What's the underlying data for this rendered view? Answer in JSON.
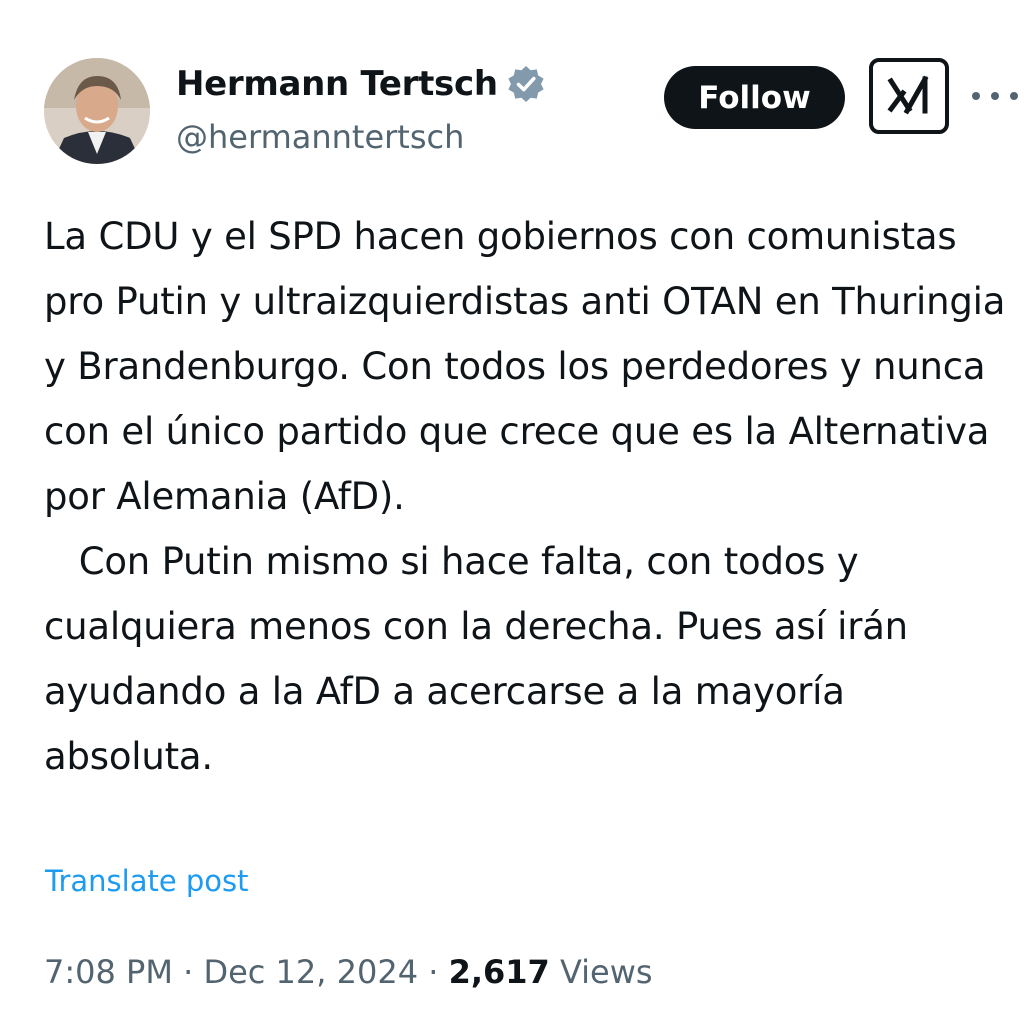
{
  "author": {
    "display_name": "Hermann Tertsch",
    "handle": "@hermanntertsch",
    "verified": true
  },
  "actions": {
    "follow_label": "Follow"
  },
  "tweet": {
    "paragraph_1": "La CDU y el SPD hacen gobiernos con comunistas pro Putin y ultraizquierdistas anti OTAN en Thuringia y Brandenburgo. Con todos los perdedores y nunca con el único partido que crece que es la Alternativa por Alemania (AfD).",
    "paragraph_2": "   Con Putin mismo si hace falta, con todos y cualquiera menos con la derecha. Pues así irán ayudando a la AfD a acercarse a la mayoría absoluta.",
    "translate_label": "Translate post"
  },
  "meta": {
    "time": "7:08 PM",
    "separator": "·",
    "date": "Dec 12, 2024",
    "views_count": "2,617",
    "views_label": "Views"
  },
  "colors": {
    "text_primary": "#0f1419",
    "text_secondary": "#536471",
    "link": "#1d9bf0",
    "verified_badge": "#829aab"
  },
  "icons": {
    "verified": "verified-badge-icon",
    "grok": "grok-icon",
    "more": "more-options-icon"
  }
}
